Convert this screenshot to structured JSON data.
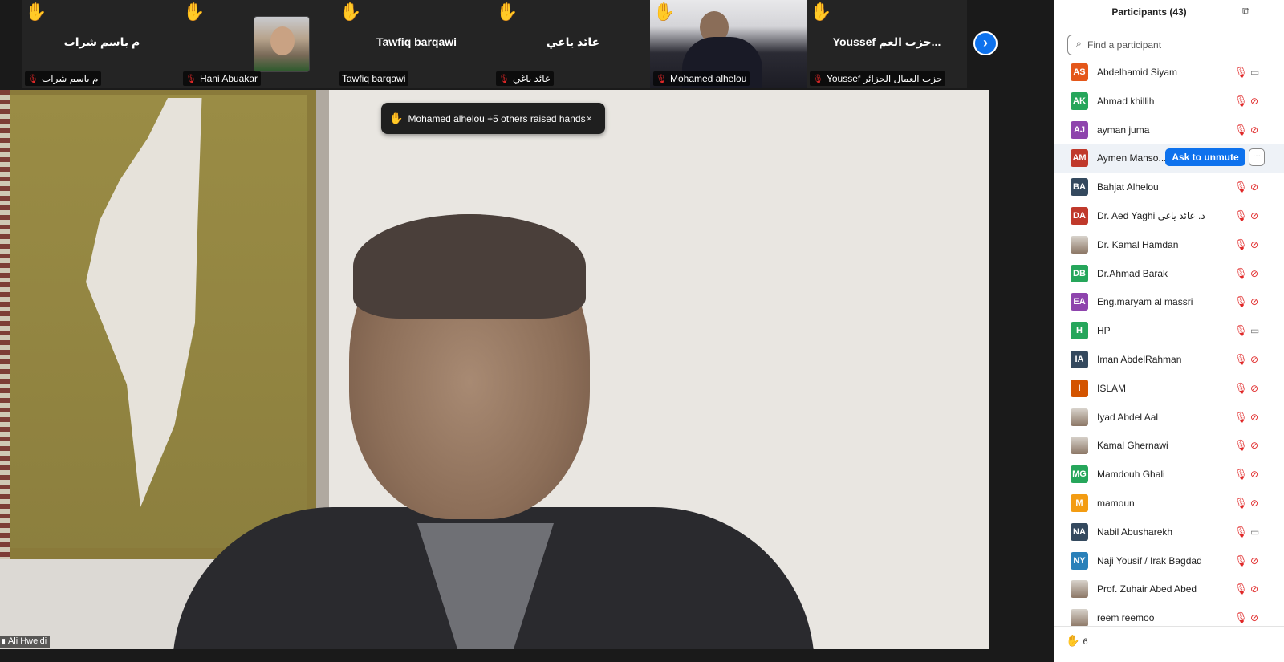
{
  "colors": {
    "accent": "#0e72ed",
    "muted_mic": "#e02828",
    "raised_hand": "#f6c143"
  },
  "strip": {
    "tiles": [
      {
        "big_name": "م باسم شراب",
        "label": "م باسم شراب",
        "type": "name"
      },
      {
        "big_name": "",
        "label": "Hani Abuakar",
        "type": "photo"
      },
      {
        "big_name": "Tawfiq barqawi",
        "label": "Tawfiq barqawi",
        "type": "name"
      },
      {
        "big_name": "عائد ياغي",
        "label": "عائد ياغي",
        "type": "name"
      },
      {
        "big_name": "",
        "label": "Mohamed alhelou",
        "type": "video"
      },
      {
        "big_name": "Youssef حزب العم...",
        "label": "Youssef حزب العمال الجزائر",
        "type": "name"
      }
    ],
    "hand_glyph": "✋",
    "next_icon": "chevron-right-icon"
  },
  "toast": {
    "text": "Mohamed alhelou +5 others raised hands",
    "close": "×"
  },
  "speaker": {
    "name": "Ali Hweidi"
  },
  "panel": {
    "title": "Participants (43)",
    "search_placeholder": "Find a participant",
    "ask_to_unmute": "Ask to unmute",
    "more": "···",
    "raised_count": "6",
    "participants": [
      {
        "initials": "AS",
        "name": "Abdelhamid Siyam",
        "color": "#e4571a",
        "cam": "off"
      },
      {
        "initials": "AK",
        "name": "Ahmad khillih",
        "color": "#26a65b",
        "cam": "muted"
      },
      {
        "initials": "AJ",
        "name": "ayman juma",
        "color": "#8e44ad",
        "cam": "muted"
      },
      {
        "initials": "AM",
        "name": "Aymen Manso...",
        "color": "#c0392b",
        "cam": "muted",
        "hover": true
      },
      {
        "initials": "BA",
        "name": "Bahjat Alhelou",
        "color": "#34495e",
        "cam": "muted"
      },
      {
        "initials": "DA",
        "name": "Dr. Aed Yaghi  د. عائد ياغي",
        "color": "#c0392b",
        "cam": "muted"
      },
      {
        "initials": "",
        "name": "Dr. Kamal Hamdan",
        "color": "",
        "cam": "muted",
        "photo": true
      },
      {
        "initials": "DB",
        "name": "Dr.Ahmad Barak",
        "color": "#26a65b",
        "cam": "muted"
      },
      {
        "initials": "EA",
        "name": "Eng.maryam al massri",
        "color": "#8e44ad",
        "cam": "muted"
      },
      {
        "initials": "H",
        "name": "HP",
        "color": "#26a65b",
        "cam": "off"
      },
      {
        "initials": "IA",
        "name": "Iman AbdelRahman",
        "color": "#34495e",
        "cam": "muted"
      },
      {
        "initials": "I",
        "name": "ISLAM",
        "color": "#d35400",
        "cam": "muted"
      },
      {
        "initials": "",
        "name": "Iyad Abdel Aal",
        "color": "",
        "cam": "muted",
        "photo": true
      },
      {
        "initials": "",
        "name": "Kamal Ghernawi",
        "color": "",
        "cam": "muted",
        "photo": true
      },
      {
        "initials": "MG",
        "name": "Mamdouh Ghali",
        "color": "#26a65b",
        "cam": "muted"
      },
      {
        "initials": "M",
        "name": "mamoun",
        "color": "#f39c12",
        "cam": "muted"
      },
      {
        "initials": "NA",
        "name": "Nabil Abusharekh",
        "color": "#34495e",
        "cam": "off"
      },
      {
        "initials": "NY",
        "name": "Naji  Yousif /  Irak  Bagdad",
        "color": "#2980b9",
        "cam": "muted"
      },
      {
        "initials": "",
        "name": "Prof. Zuhair Abed Abed",
        "color": "",
        "cam": "muted",
        "photo": true
      },
      {
        "initials": "",
        "name": "reem reemoo",
        "color": "",
        "cam": "muted",
        "photo": true
      }
    ]
  }
}
